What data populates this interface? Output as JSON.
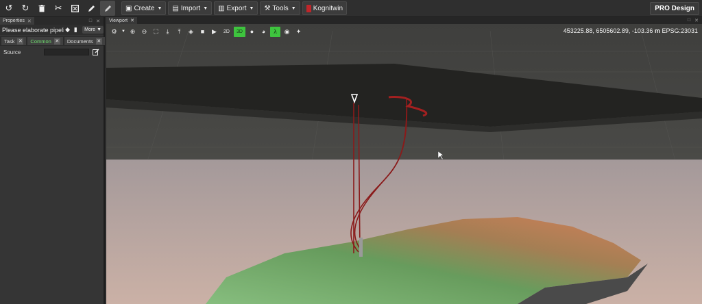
{
  "toolbar": {
    "icons": [
      "undo-icon",
      "redo-icon",
      "delete-icon",
      "cut-icon",
      "frame-icon",
      "pencil-icon",
      "pencil-alt-icon"
    ],
    "menus": [
      {
        "label": "Create",
        "icon": "create-icon"
      },
      {
        "label": "Import",
        "icon": "import-icon"
      },
      {
        "label": "Export",
        "icon": "export-icon"
      },
      {
        "label": "Tools",
        "icon": "tools-icon"
      },
      {
        "label": "Kognitwin",
        "icon": "kognitwin-logo-icon"
      }
    ],
    "pro_label": "PRO Design"
  },
  "properties_panel": {
    "tab_label": "Properties",
    "title": "Please elaborate pipeli...",
    "more_label": "More",
    "subtabs": [
      {
        "label": "Task",
        "active": false
      },
      {
        "label": "Common",
        "active": true
      },
      {
        "label": "Documents",
        "active": false
      }
    ],
    "source_label": "Source",
    "source_value": ""
  },
  "viewport": {
    "tab_label": "Viewport",
    "mode_2d": "2D",
    "mode_3d": "3D",
    "active_mode": "3D",
    "coords_text": "453225.88, 6505602.89, -103.36",
    "coords_unit": "m",
    "crs": "EPSG:23031"
  },
  "colors": {
    "accent_green": "#3ec43e",
    "well_red": "#8a1a1a",
    "brand_red": "#c0262a"
  }
}
